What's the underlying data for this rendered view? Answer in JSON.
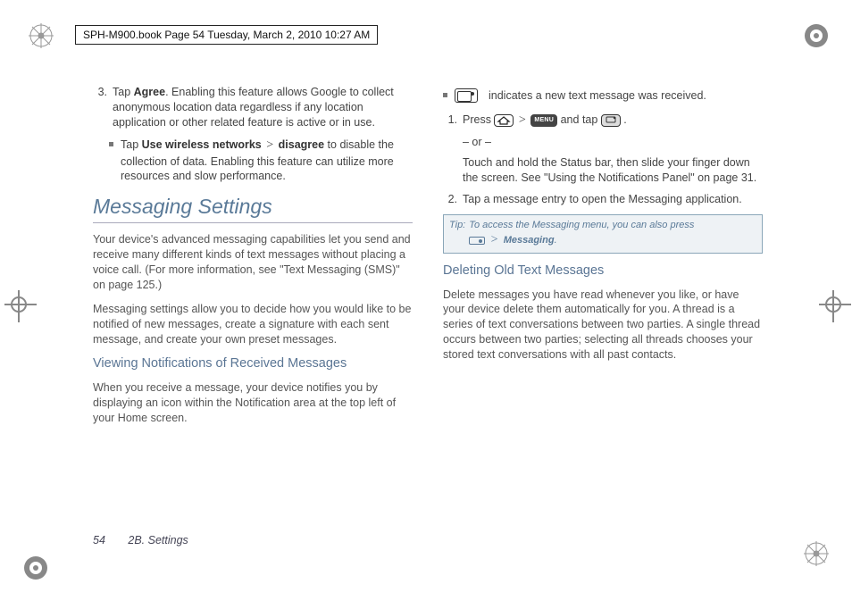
{
  "header": "SPH-M900.book  Page 54  Tuesday, March 2, 2010  10:27 AM",
  "col1": {
    "step3_num": "3.",
    "step3_prefix": "Tap ",
    "step3_bold": "Agree",
    "step3_text": ". Enabling this feature allows Google to collect anonymous location data regardless if any location application or other related feature is active or in use.",
    "bullet_prefix": "Tap ",
    "bullet_bold1": "Use wireless networks",
    "bullet_gt": " > ",
    "bullet_bold2": "disagree",
    "bullet_text": " to disable the collection of data. Enabling this feature can utilize more resources and slow performance.",
    "section_title": "Messaging Settings",
    "para1": "Your device's advanced messaging capabilities let you send and receive many different kinds of text messages without placing a voice call. (For more information, see \"Text Messaging (SMS)\" on page 125.)",
    "para2": "Messaging settings allow you to decide how you would like to be notified of new messages, create a signature with each sent message, and create your own preset messages.",
    "sub1": "Viewing Notifications of Received Messages",
    "para3": "When you receive a message, your device notifies you by displaying an icon within the Notification area at the top left of your Home screen."
  },
  "col2": {
    "bullet_text": "indicates a new text message was received.",
    "step1_num": "1.",
    "step1_a": "Press ",
    "step1_b": " and tap ",
    "step1_dot": " .",
    "or": "– or –",
    "step1_c": "Touch and hold the Status bar, then slide your finger down the screen. See \"Using the Notifications Panel\" on page 31.",
    "step2_num": "2.",
    "step2_text": "Tap a message entry to open the Messaging application.",
    "tip_label": "Tip:",
    "tip_text_a": "To access the Messaging menu, you can also press",
    "tip_gt": " > ",
    "tip_bold": "Messaging",
    "tip_dot": ".",
    "sub2": "Deleting Old Text Messages",
    "para4": "Delete messages you have read whenever you like, or have your device delete them automatically for you. A thread is a series of text conversations between two parties. A single thread occurs between two parties; selecting all threads chooses your stored text conversations with all past contacts.",
    "icons": {
      "home_label": "home-icon",
      "menu_label": "MENU",
      "app_label": "app-icon"
    }
  },
  "footer": {
    "page": "54",
    "chapter": "2B. Settings"
  }
}
